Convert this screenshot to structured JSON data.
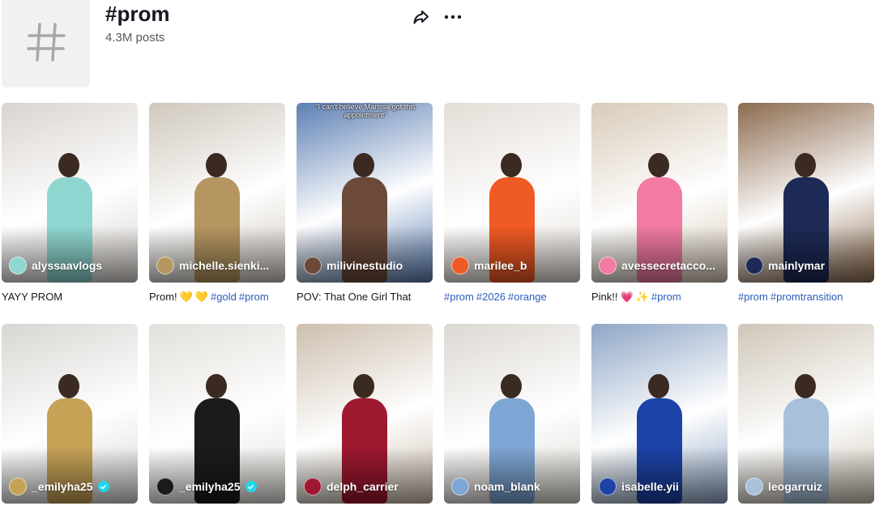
{
  "hashtag": {
    "title": "#prom",
    "posts_count": "4.3M posts",
    "icon": "hashtag-icon"
  },
  "actions": {
    "share_icon": "share-icon",
    "more_icon": "more-icon"
  },
  "videos": [
    {
      "username": "alyssaavlogs",
      "verified": false,
      "caption_text": "YAYY PROM",
      "hashtags": [],
      "emojis": [],
      "bg": "#d9d4cf",
      "dress": "#8fd6d0"
    },
    {
      "username": "michelle.sienki...",
      "verified": false,
      "caption_text": "Prom!",
      "emojis": [
        "💛",
        "💛"
      ],
      "hashtags": [
        "#gold",
        "#prom"
      ],
      "bg": "#cfc8bd",
      "dress": "#b59660"
    },
    {
      "username": "milivinestudio",
      "verified": false,
      "caption_text": "POV: That One Girl That",
      "hashtags": [],
      "emojis": [],
      "overlay": "\"I can't believe Marissa got this appointment\"",
      "bg": "#5d7fb4",
      "dress": "#6b4a3a"
    },
    {
      "username": "marilee_b",
      "verified": false,
      "caption_text": "",
      "hashtags": [
        "#prom",
        "#2026",
        "#orange"
      ],
      "emojis": [],
      "bg": "#e3ddd6",
      "dress": "#f05a24"
    },
    {
      "username": "avessecretacco...",
      "verified": false,
      "caption_text": "Pink!!",
      "emojis": [
        "💗",
        "✨"
      ],
      "hashtags": [
        "#prom"
      ],
      "bg": "#d8cbb9",
      "dress": "#f27aa3"
    },
    {
      "username": "mainlymar",
      "verified": false,
      "caption_text": "",
      "hashtags": [
        "#prom",
        "#promtransition"
      ],
      "emojis": [],
      "bg": "#8b6a4e",
      "dress": "#1d2a55"
    },
    {
      "username": "_emilyha25",
      "verified": true,
      "caption_text": "",
      "hashtags": [],
      "emojis": [],
      "bg": "#d8d6d2",
      "dress": "#c6a257"
    },
    {
      "username": "_emilyha25",
      "verified": true,
      "caption_text": "",
      "hashtags": [],
      "emojis": [],
      "bg": "#e2e0db",
      "dress": "#1b1b1d"
    },
    {
      "username": "delph_carrier",
      "verified": false,
      "caption_text": "",
      "hashtags": [],
      "emojis": [],
      "bg": "#cdbfae",
      "dress": "#9e1830"
    },
    {
      "username": "noam_blank",
      "verified": false,
      "caption_text": "",
      "hashtags": [],
      "emojis": [],
      "bg": "#dcd8d2",
      "dress": "#7ea6d4"
    },
    {
      "username": "isabelle.yii",
      "verified": false,
      "caption_text": "",
      "hashtags": [],
      "emojis": [],
      "bg": "#8fa6c6",
      "dress": "#1c43a8"
    },
    {
      "username": "leogarruiz",
      "verified": false,
      "caption_text": "",
      "hashtags": [],
      "emojis": [],
      "bg": "#cfc6b8",
      "dress": "#a8c0da"
    }
  ]
}
